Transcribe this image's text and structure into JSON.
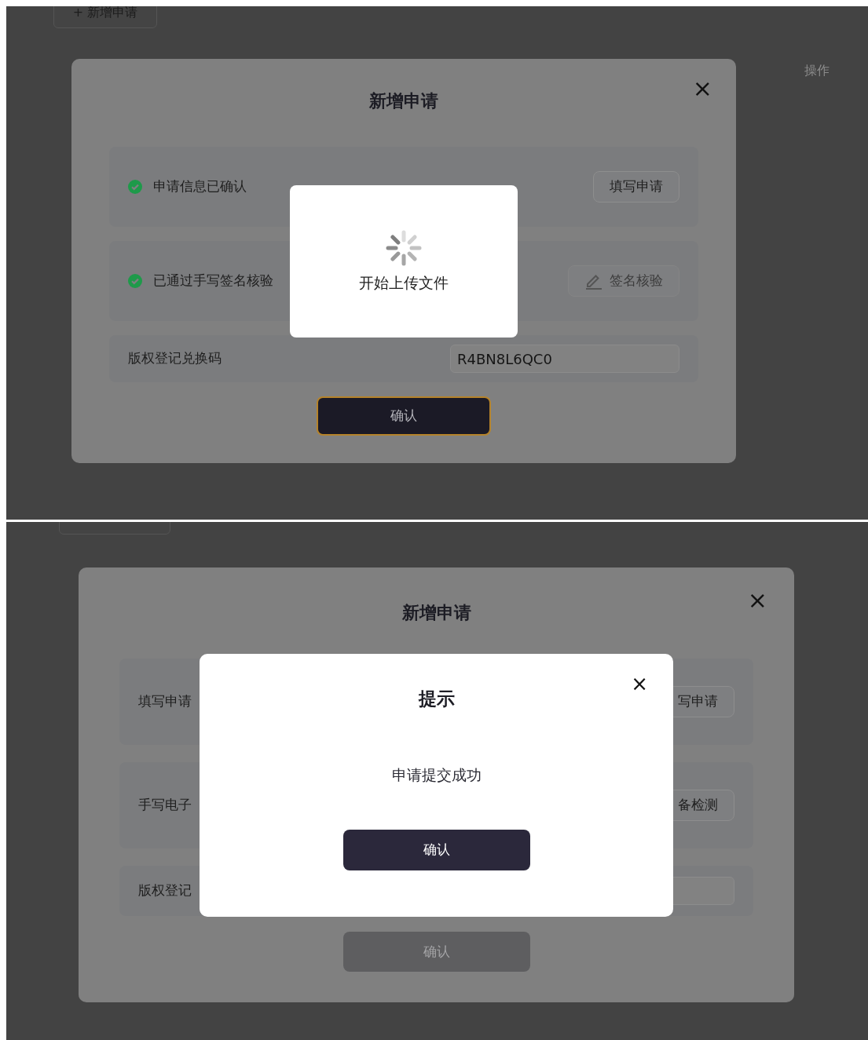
{
  "screens": [
    {
      "page": {
        "add_button": "+ 新增申请",
        "column_header": "操作"
      },
      "modal": {
        "title": "新增申请",
        "close": "×",
        "rows": [
          {
            "kind": "status",
            "checked": true,
            "label": "申请信息已确认",
            "button": "填写申请",
            "button_disabled": false,
            "button_icon": false
          },
          {
            "kind": "status",
            "checked": true,
            "label": "已通过手写签名核验",
            "button": "签名核验",
            "button_disabled": true,
            "button_icon": true
          },
          {
            "kind": "field",
            "label": "版权登记兑换码",
            "value": "R4BN8L6QC0"
          }
        ],
        "confirm": {
          "label": "确认",
          "disabled": false,
          "focused": true
        }
      },
      "toast": {
        "message": "开始上传文件"
      }
    },
    {
      "modal": {
        "title": "新增申请",
        "close": "×",
        "rows": [
          {
            "kind": "status",
            "checked": false,
            "label": "填写申请",
            "button": "写申请",
            "button_disabled": false
          },
          {
            "kind": "status",
            "checked": false,
            "label": "手写电子",
            "button": "备检测",
            "button_disabled": false
          },
          {
            "kind": "field",
            "label": "版权登记"
          }
        ],
        "confirm": {
          "label": "确认",
          "disabled": true,
          "focused": false
        }
      },
      "dialog": {
        "title": "提示",
        "close": "×",
        "message": "申请提交成功",
        "button": "确认"
      }
    }
  ]
}
